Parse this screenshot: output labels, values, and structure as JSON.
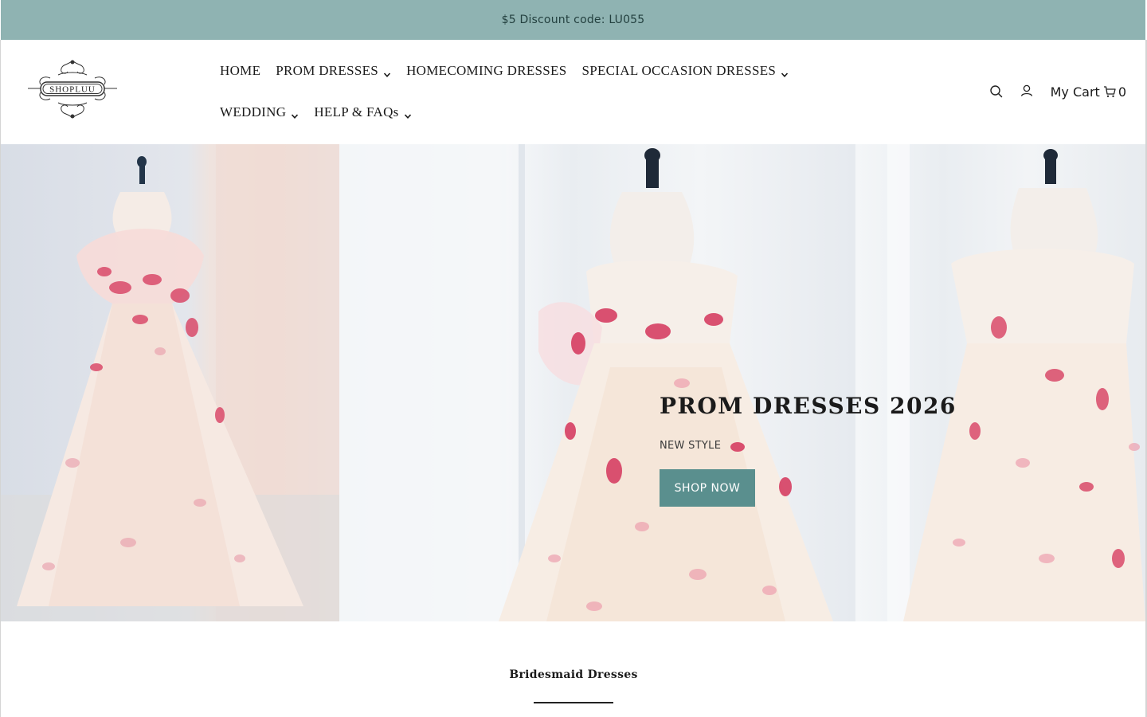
{
  "announcement": {
    "text": "$5 Discount code: LU055"
  },
  "logo": {
    "text": "SHOPLUU"
  },
  "nav": {
    "row1": [
      {
        "label": "HOME",
        "dropdown": false
      },
      {
        "label": "PROM DRESSES",
        "dropdown": true
      },
      {
        "label": "HOMECOMING DRESSES",
        "dropdown": false
      },
      {
        "label": "SPECIAL OCCASION DRESSES",
        "dropdown": true
      }
    ],
    "row2": [
      {
        "label": "WEDDING",
        "dropdown": true
      },
      {
        "label": "HELP & FAQs",
        "dropdown": true
      }
    ]
  },
  "tools": {
    "search_icon": "search-icon",
    "account_icon": "user-icon",
    "cart_label": "My Cart",
    "cart_icon": "cart-icon",
    "cart_count": "0"
  },
  "hero": {
    "title": "PROM DRESSES 2026",
    "subtitle": "NEW STYLE",
    "button_label": "SHOP NOW"
  },
  "section": {
    "title": "Bridesmaid Dresses"
  },
  "colors": {
    "announcement_bg": "#8fb3b2",
    "button_bg": "#5a8f8e",
    "text": "#1a1a1a"
  }
}
